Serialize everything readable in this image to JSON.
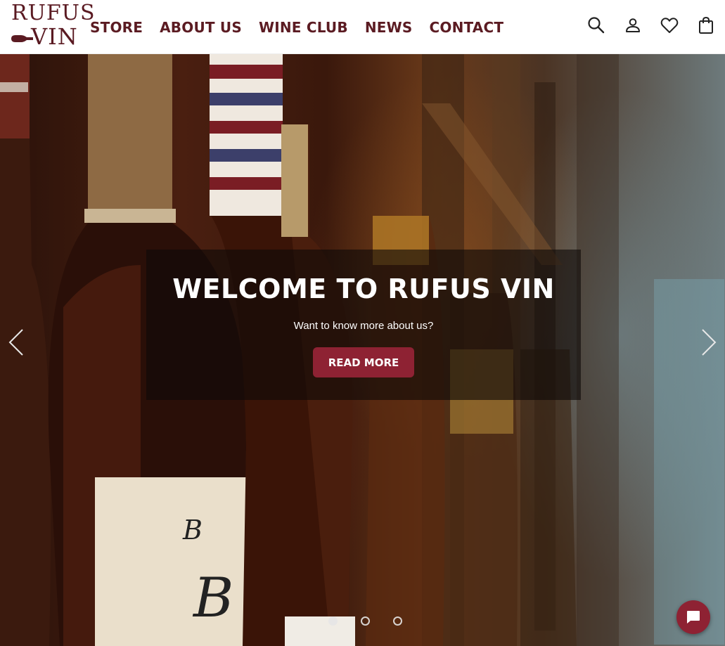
{
  "brand": {
    "logo_line1": "RUFUS",
    "logo_line2": "VIN",
    "color": "#5b1b22"
  },
  "nav": {
    "items": [
      {
        "label": "STORE"
      },
      {
        "label": "ABOUT US"
      },
      {
        "label": "WINE CLUB"
      },
      {
        "label": "NEWS"
      },
      {
        "label": "CONTACT"
      }
    ]
  },
  "header_icons": [
    "search-icon",
    "account-icon",
    "wishlist-heart-icon",
    "shopping-bag-icon"
  ],
  "hero": {
    "title": "WELCOME TO RUFUS VIN",
    "subtitle": "Want to know more about us?",
    "cta_label": "READ MORE",
    "cta_color": "#8e2233",
    "slides_total": 3,
    "active_slide": 1
  },
  "chat": {
    "icon": "chat-bubble-icon",
    "color": "#8e2233"
  }
}
